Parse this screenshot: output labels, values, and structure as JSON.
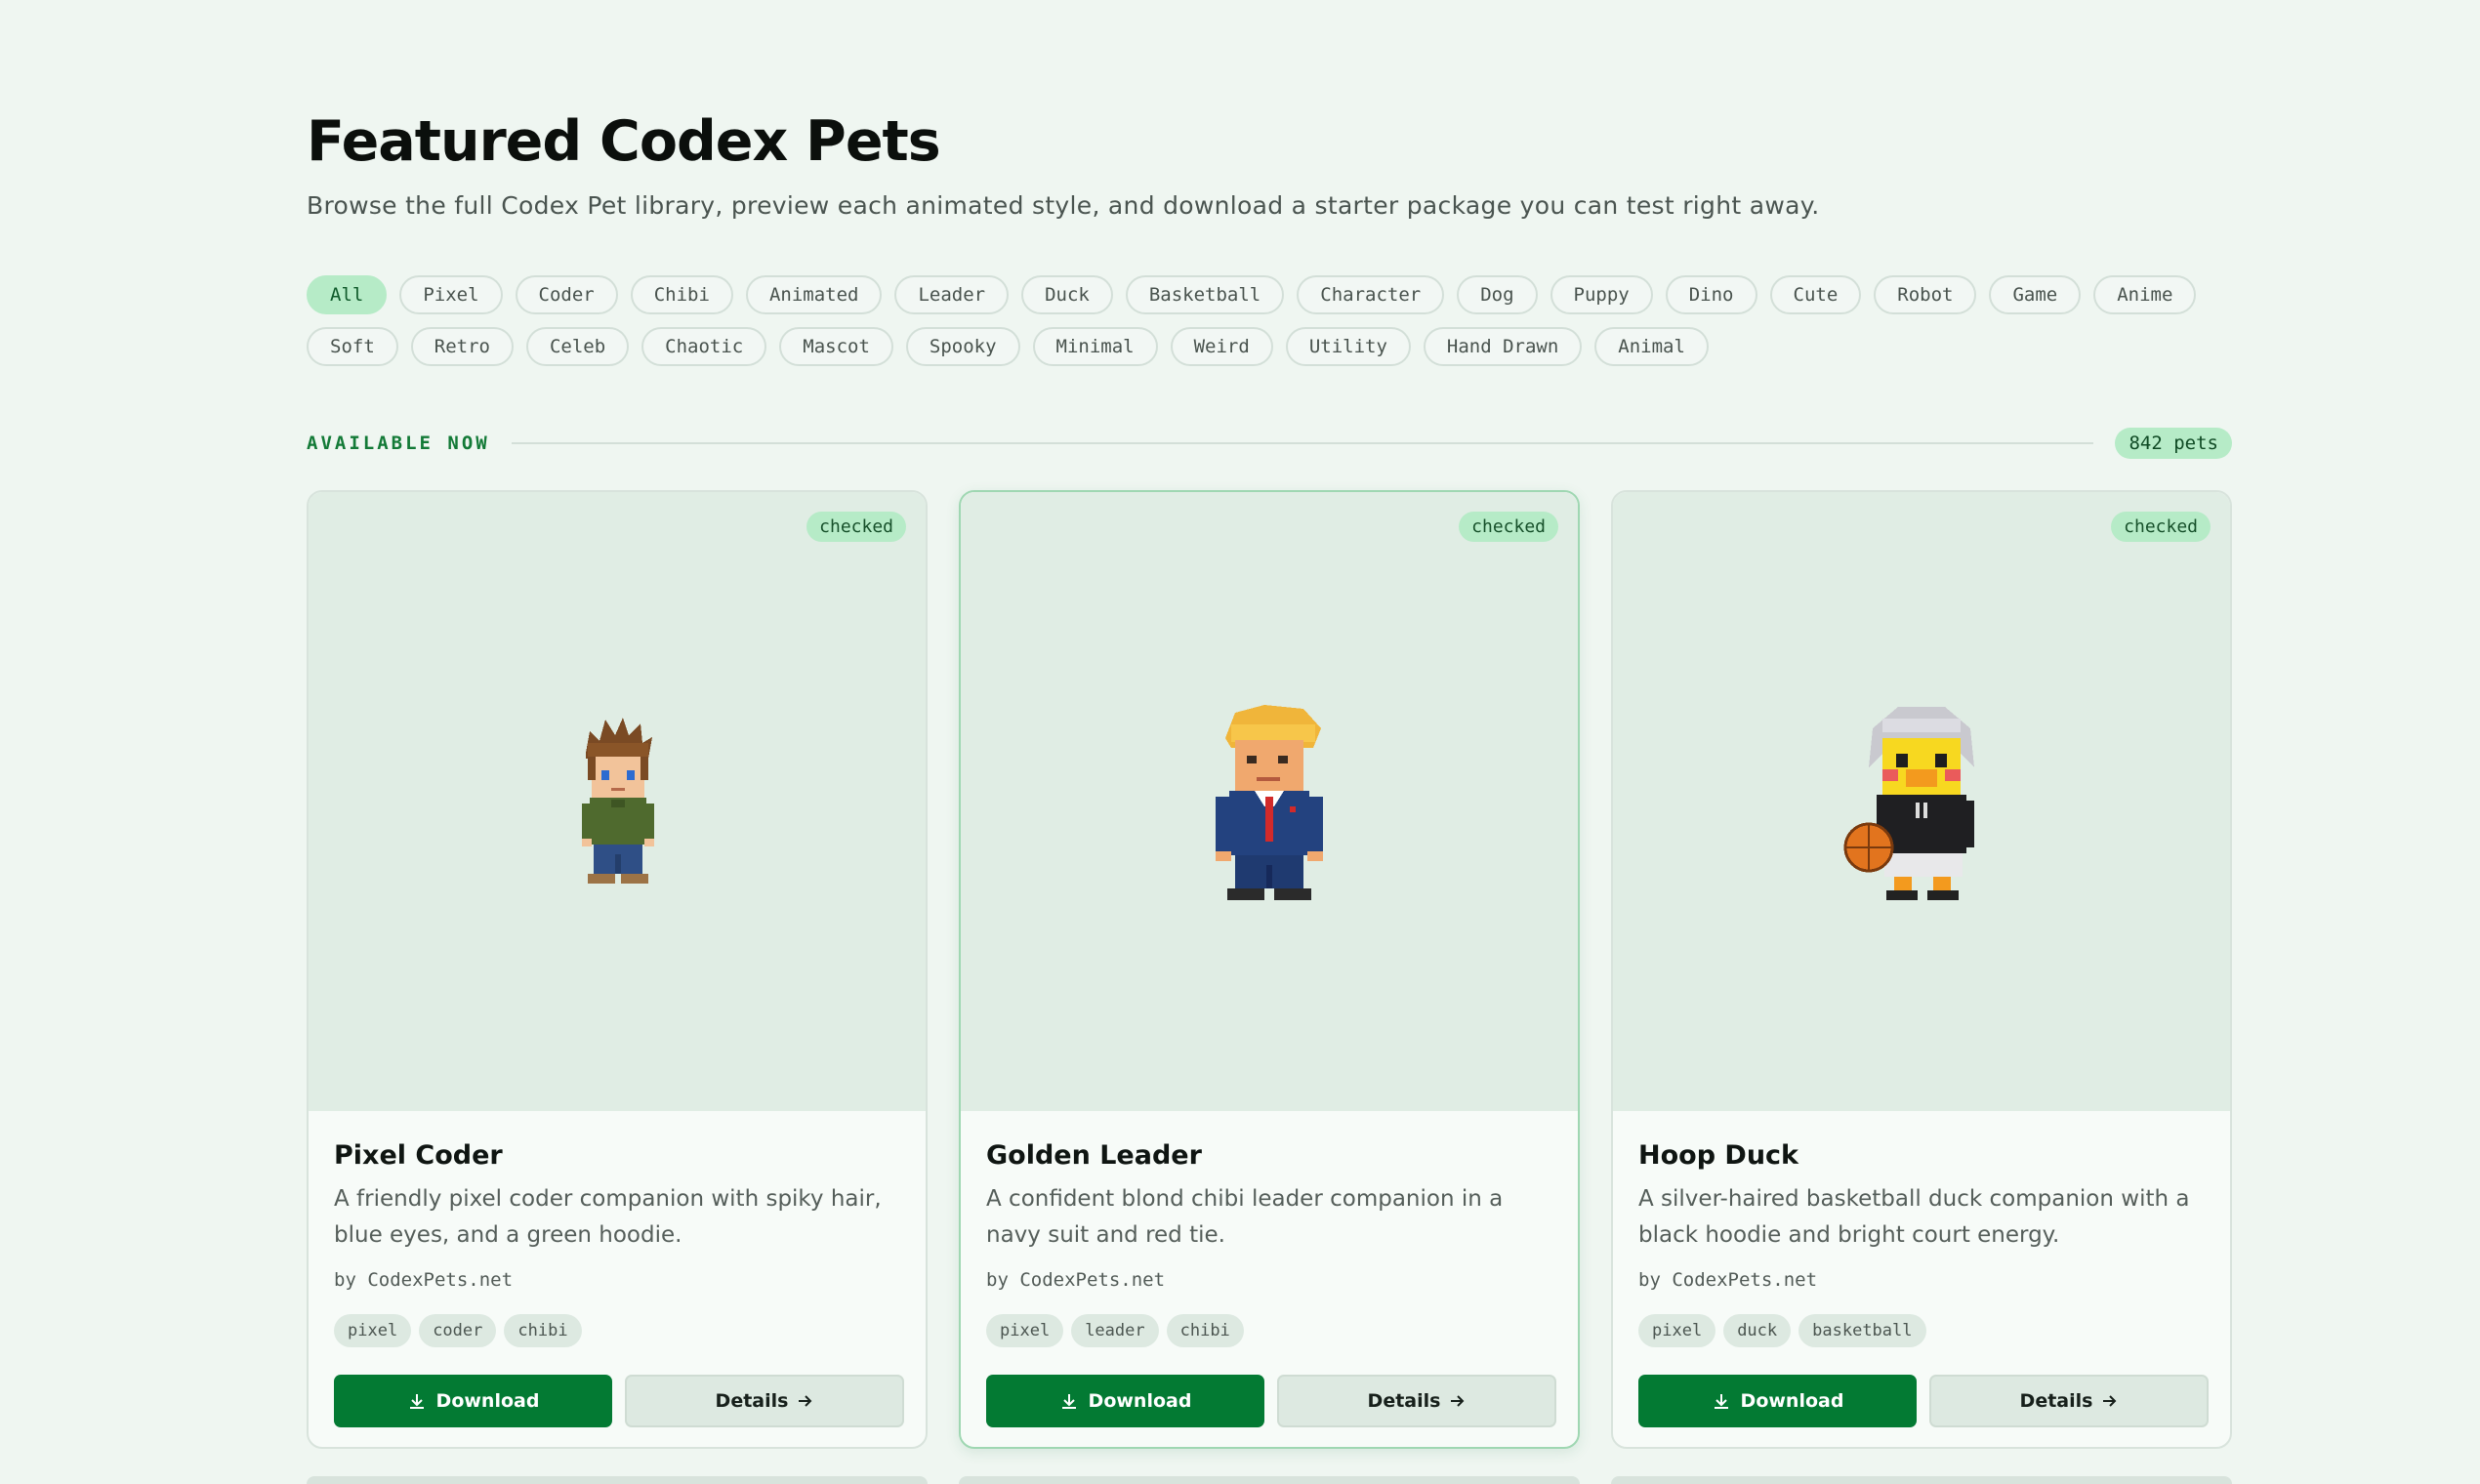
{
  "header": {
    "title": "Featured Codex Pets",
    "subtitle": "Browse the full Codex Pet library, preview each animated style, and download a starter package you can test right away."
  },
  "filters": {
    "row1": [
      "All",
      "Pixel",
      "Coder",
      "Chibi",
      "Animated",
      "Leader",
      "Duck",
      "Basketball",
      "Character",
      "Dog",
      "Puppy",
      "Dino",
      "Cute",
      "Robot",
      "Game",
      "Anime"
    ],
    "row2": [
      "Soft",
      "Retro",
      "Celeb",
      "Chaotic",
      "Mascot",
      "Spooky",
      "Minimal",
      "Weird",
      "Utility",
      "Hand Drawn",
      "Animal"
    ],
    "active": "All"
  },
  "section": {
    "label": "AVAILABLE NOW",
    "count": "842 pets"
  },
  "cards": [
    {
      "badge": "checked",
      "title": "Pixel Coder",
      "description": "A friendly pixel coder companion with spiky hair, blue eyes, and a green hoodie.",
      "author": "by CodexPets.net",
      "tags": [
        "pixel",
        "coder",
        "chibi"
      ],
      "download_label": "Download",
      "details_label": "Details"
    },
    {
      "badge": "checked",
      "title": "Golden Leader",
      "description": "A confident blond chibi leader companion in a navy suit and red tie.",
      "author": "by CodexPets.net",
      "tags": [
        "pixel",
        "leader",
        "chibi"
      ],
      "download_label": "Download",
      "details_label": "Details"
    },
    {
      "badge": "checked",
      "title": "Hoop Duck",
      "description": "A silver-haired basketball duck companion with a black hoodie and bright court energy.",
      "author": "by CodexPets.net",
      "tags": [
        "pixel",
        "duck",
        "basketball"
      ],
      "download_label": "Download",
      "details_label": "Details"
    }
  ],
  "icons": {
    "download": "download-icon",
    "details": "arrow-right-icon"
  },
  "colors": {
    "accent": "#037a33",
    "chip_active": "#b6ebc7",
    "background": "#eff6f1"
  }
}
